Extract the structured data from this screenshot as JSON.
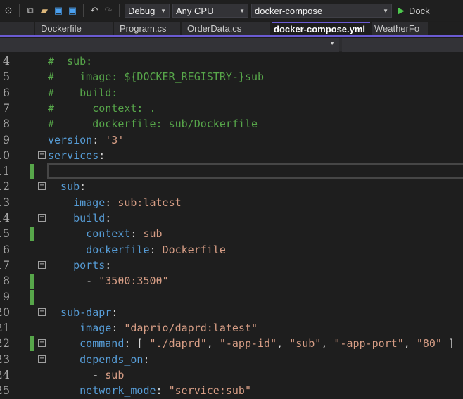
{
  "toolbar": {
    "config": "Debug",
    "platform": "Any CPU",
    "startup": "docker-compose",
    "run_label": "Dock"
  },
  "tabs": [
    {
      "label": "Dockerfile"
    },
    {
      "label": "Program.cs"
    },
    {
      "label": "OrderData.cs"
    },
    {
      "label": "docker-compose.yml",
      "active": true
    },
    {
      "label": "WeatherFo"
    }
  ],
  "colors": {
    "comment": "#57a64a",
    "key": "#569cd6",
    "value": "#d69d85",
    "accent": "#6b5bd2"
  },
  "editor": {
    "lines": [
      {
        "n": "4",
        "tok": [
          [
            "#  sub:",
            "com"
          ]
        ]
      },
      {
        "n": "5",
        "tok": [
          [
            "#    image: ${DOCKER_REGISTRY-}sub",
            "com"
          ]
        ]
      },
      {
        "n": "6",
        "tok": [
          [
            "#    build:",
            "com"
          ]
        ]
      },
      {
        "n": "7",
        "tok": [
          [
            "#      context: .",
            "com"
          ]
        ]
      },
      {
        "n": "8",
        "tok": [
          [
            "#      dockerfile: sub/Dockerfile",
            "com"
          ]
        ]
      },
      {
        "n": "9",
        "tok": [
          [
            "version",
            "key"
          ],
          [
            ": ",
            "pun"
          ],
          [
            "'3'",
            "val"
          ]
        ]
      },
      {
        "n": "10",
        "tok": [
          [
            "services",
            "key"
          ],
          [
            ":",
            "pun"
          ]
        ],
        "fold": true
      },
      {
        "n": "11",
        "tok": [],
        "changed": true,
        "current": true
      },
      {
        "n": "12",
        "tok": [
          [
            "  sub",
            "key"
          ],
          [
            ":",
            "pun"
          ]
        ],
        "fold": true
      },
      {
        "n": "13",
        "tok": [
          [
            "    image",
            "key"
          ],
          [
            ": ",
            "pun"
          ],
          [
            "sub:latest",
            "val"
          ]
        ]
      },
      {
        "n": "14",
        "tok": [
          [
            "    build",
            "key"
          ],
          [
            ":",
            "pun"
          ]
        ],
        "fold": true
      },
      {
        "n": "15",
        "tok": [
          [
            "      context",
            "key"
          ],
          [
            ": ",
            "pun"
          ],
          [
            "sub",
            "val"
          ]
        ],
        "changed": true
      },
      {
        "n": "16",
        "tok": [
          [
            "      dockerfile",
            "key"
          ],
          [
            ": ",
            "pun"
          ],
          [
            "Dockerfile",
            "val"
          ]
        ]
      },
      {
        "n": "17",
        "tok": [
          [
            "    ports",
            "key"
          ],
          [
            ":",
            "pun"
          ]
        ],
        "fold": true
      },
      {
        "n": "18",
        "tok": [
          [
            "      - ",
            "pun"
          ],
          [
            "\"3500:3500\"",
            "val"
          ]
        ],
        "changed": true
      },
      {
        "n": "19",
        "tok": [],
        "changed": true
      },
      {
        "n": "20",
        "tok": [
          [
            "  sub-dapr",
            "key"
          ],
          [
            ":",
            "pun"
          ]
        ],
        "fold": true
      },
      {
        "n": "21",
        "tok": [
          [
            "     image",
            "key"
          ],
          [
            ": ",
            "pun"
          ],
          [
            "\"daprio/daprd:latest\"",
            "val"
          ]
        ]
      },
      {
        "n": "22",
        "tok": [
          [
            "     command",
            "key"
          ],
          [
            ": [ ",
            "pun"
          ],
          [
            "\"./daprd\"",
            "val"
          ],
          [
            ", ",
            "pun"
          ],
          [
            "\"-app-id\"",
            "val"
          ],
          [
            ", ",
            "pun"
          ],
          [
            "\"sub\"",
            "val"
          ],
          [
            ", ",
            "pun"
          ],
          [
            "\"-app-port\"",
            "val"
          ],
          [
            ", ",
            "pun"
          ],
          [
            "\"80\"",
            "val"
          ],
          [
            " ]",
            "pun"
          ]
        ],
        "changed": true,
        "fold": true
      },
      {
        "n": "23",
        "tok": [
          [
            "     depends_on",
            "key"
          ],
          [
            ":",
            "pun"
          ]
        ],
        "fold": true
      },
      {
        "n": "24",
        "tok": [
          [
            "       - ",
            "pun"
          ],
          [
            "sub",
            "val"
          ]
        ]
      },
      {
        "n": "25",
        "tok": [
          [
            "     network_mode",
            "key"
          ],
          [
            ": ",
            "pun"
          ],
          [
            "\"service:sub\"",
            "val"
          ]
        ]
      }
    ]
  }
}
